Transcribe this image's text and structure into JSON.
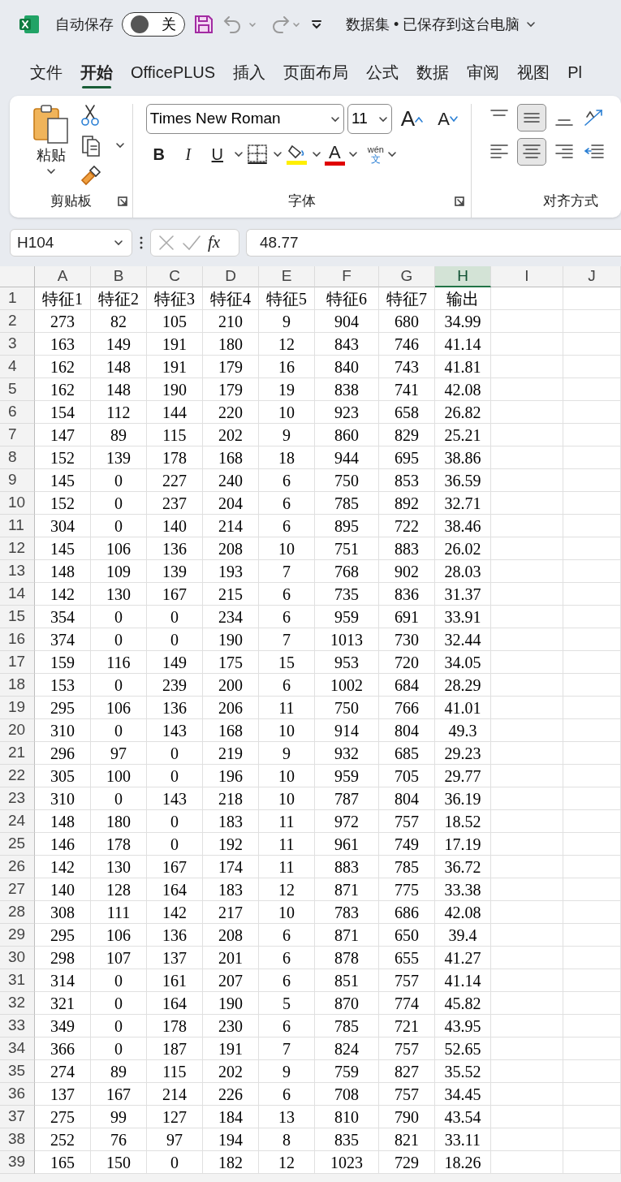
{
  "title_bar": {
    "autosave_label": "自动保存",
    "autosave": {
      "on": false,
      "state_label": "关"
    },
    "title": "数据集 • 已保存到这台电脑"
  },
  "tabs": [
    {
      "label": "文件",
      "selected": false
    },
    {
      "label": "开始",
      "selected": true
    },
    {
      "label": "OfficePLUS",
      "selected": false
    },
    {
      "label": "插入",
      "selected": false
    },
    {
      "label": "页面布局",
      "selected": false
    },
    {
      "label": "公式",
      "selected": false
    },
    {
      "label": "数据",
      "selected": false
    },
    {
      "label": "审阅",
      "selected": false
    },
    {
      "label": "视图",
      "selected": false
    },
    {
      "label": "Pl",
      "selected": false
    }
  ],
  "ribbon": {
    "clipboard": {
      "paste_label": "粘贴",
      "group_label": "剪贴板"
    },
    "font": {
      "font_name": "Times New Roman",
      "font_size": "11",
      "grow_label": "A",
      "shrink_label": "A",
      "bold_label": "B",
      "italic_label": "I",
      "underline_label": "U",
      "font_color_label": "A",
      "phonetic_top": "wén",
      "phonetic_bottom": "文",
      "group_label": "字体"
    },
    "alignment": {
      "group_label": "对齐方式",
      "top_row": [
        {
          "selected": false
        },
        {
          "selected": true
        },
        {
          "selected": false
        }
      ],
      "bottom_row": [
        {
          "selected": false
        },
        {
          "selected": true
        },
        {
          "selected": false
        }
      ]
    }
  },
  "formula_bar": {
    "name_box": "H104",
    "fx_label": "fx",
    "value": "48.77"
  },
  "sheet": {
    "columns": [
      {
        "label": "A",
        "selected": false
      },
      {
        "label": "B",
        "selected": false
      },
      {
        "label": "C",
        "selected": false
      },
      {
        "label": "D",
        "selected": false
      },
      {
        "label": "E",
        "selected": false
      },
      {
        "label": "F",
        "selected": false
      },
      {
        "label": "G",
        "selected": false
      },
      {
        "label": "H",
        "selected": true
      },
      {
        "label": "I",
        "selected": false
      },
      {
        "label": "J",
        "selected": false
      }
    ],
    "rows": [
      {
        "number": "1",
        "cells": [
          "特征1",
          "特征2",
          "特征3",
          "特征4",
          "特征5",
          "特征6",
          "特征7",
          "输出"
        ]
      },
      {
        "number": "2",
        "cells": [
          "273",
          "82",
          "105",
          "210",
          "9",
          "904",
          "680",
          "34.99"
        ]
      },
      {
        "number": "3",
        "cells": [
          "163",
          "149",
          "191",
          "180",
          "12",
          "843",
          "746",
          "41.14"
        ]
      },
      {
        "number": "4",
        "cells": [
          "162",
          "148",
          "191",
          "179",
          "16",
          "840",
          "743",
          "41.81"
        ]
      },
      {
        "number": "5",
        "cells": [
          "162",
          "148",
          "190",
          "179",
          "19",
          "838",
          "741",
          "42.08"
        ]
      },
      {
        "number": "6",
        "cells": [
          "154",
          "112",
          "144",
          "220",
          "10",
          "923",
          "658",
          "26.82"
        ]
      },
      {
        "number": "7",
        "cells": [
          "147",
          "89",
          "115",
          "202",
          "9",
          "860",
          "829",
          "25.21"
        ]
      },
      {
        "number": "8",
        "cells": [
          "152",
          "139",
          "178",
          "168",
          "18",
          "944",
          "695",
          "38.86"
        ]
      },
      {
        "number": "9",
        "cells": [
          "145",
          "0",
          "227",
          "240",
          "6",
          "750",
          "853",
          "36.59"
        ]
      },
      {
        "number": "10",
        "cells": [
          "152",
          "0",
          "237",
          "204",
          "6",
          "785",
          "892",
          "32.71"
        ]
      },
      {
        "number": "11",
        "cells": [
          "304",
          "0",
          "140",
          "214",
          "6",
          "895",
          "722",
          "38.46"
        ]
      },
      {
        "number": "12",
        "cells": [
          "145",
          "106",
          "136",
          "208",
          "10",
          "751",
          "883",
          "26.02"
        ]
      },
      {
        "number": "13",
        "cells": [
          "148",
          "109",
          "139",
          "193",
          "7",
          "768",
          "902",
          "28.03"
        ]
      },
      {
        "number": "14",
        "cells": [
          "142",
          "130",
          "167",
          "215",
          "6",
          "735",
          "836",
          "31.37"
        ]
      },
      {
        "number": "15",
        "cells": [
          "354",
          "0",
          "0",
          "234",
          "6",
          "959",
          "691",
          "33.91"
        ]
      },
      {
        "number": "16",
        "cells": [
          "374",
          "0",
          "0",
          "190",
          "7",
          "1013",
          "730",
          "32.44"
        ]
      },
      {
        "number": "17",
        "cells": [
          "159",
          "116",
          "149",
          "175",
          "15",
          "953",
          "720",
          "34.05"
        ]
      },
      {
        "number": "18",
        "cells": [
          "153",
          "0",
          "239",
          "200",
          "6",
          "1002",
          "684",
          "28.29"
        ]
      },
      {
        "number": "19",
        "cells": [
          "295",
          "106",
          "136",
          "206",
          "11",
          "750",
          "766",
          "41.01"
        ]
      },
      {
        "number": "20",
        "cells": [
          "310",
          "0",
          "143",
          "168",
          "10",
          "914",
          "804",
          "49.3"
        ]
      },
      {
        "number": "21",
        "cells": [
          "296",
          "97",
          "0",
          "219",
          "9",
          "932",
          "685",
          "29.23"
        ]
      },
      {
        "number": "22",
        "cells": [
          "305",
          "100",
          "0",
          "196",
          "10",
          "959",
          "705",
          "29.77"
        ]
      },
      {
        "number": "23",
        "cells": [
          "310",
          "0",
          "143",
          "218",
          "10",
          "787",
          "804",
          "36.19"
        ]
      },
      {
        "number": "24",
        "cells": [
          "148",
          "180",
          "0",
          "183",
          "11",
          "972",
          "757",
          "18.52"
        ]
      },
      {
        "number": "25",
        "cells": [
          "146",
          "178",
          "0",
          "192",
          "11",
          "961",
          "749",
          "17.19"
        ]
      },
      {
        "number": "26",
        "cells": [
          "142",
          "130",
          "167",
          "174",
          "11",
          "883",
          "785",
          "36.72"
        ]
      },
      {
        "number": "27",
        "cells": [
          "140",
          "128",
          "164",
          "183",
          "12",
          "871",
          "775",
          "33.38"
        ]
      },
      {
        "number": "28",
        "cells": [
          "308",
          "111",
          "142",
          "217",
          "10",
          "783",
          "686",
          "42.08"
        ]
      },
      {
        "number": "29",
        "cells": [
          "295",
          "106",
          "136",
          "208",
          "6",
          "871",
          "650",
          "39.4"
        ]
      },
      {
        "number": "30",
        "cells": [
          "298",
          "107",
          "137",
          "201",
          "6",
          "878",
          "655",
          "41.27"
        ]
      },
      {
        "number": "31",
        "cells": [
          "314",
          "0",
          "161",
          "207",
          "6",
          "851",
          "757",
          "41.14"
        ]
      },
      {
        "number": "32",
        "cells": [
          "321",
          "0",
          "164",
          "190",
          "5",
          "870",
          "774",
          "45.82"
        ]
      },
      {
        "number": "33",
        "cells": [
          "349",
          "0",
          "178",
          "230",
          "6",
          "785",
          "721",
          "43.95"
        ]
      },
      {
        "number": "34",
        "cells": [
          "366",
          "0",
          "187",
          "191",
          "7",
          "824",
          "757",
          "52.65"
        ]
      },
      {
        "number": "35",
        "cells": [
          "274",
          "89",
          "115",
          "202",
          "9",
          "759",
          "827",
          "35.52"
        ]
      },
      {
        "number": "36",
        "cells": [
          "137",
          "167",
          "214",
          "226",
          "6",
          "708",
          "757",
          "34.45"
        ]
      },
      {
        "number": "37",
        "cells": [
          "275",
          "99",
          "127",
          "184",
          "13",
          "810",
          "790",
          "43.54"
        ]
      },
      {
        "number": "38",
        "cells": [
          "252",
          "76",
          "97",
          "194",
          "8",
          "835",
          "821",
          "33.11"
        ]
      },
      {
        "number": "39",
        "cells": [
          "165",
          "150",
          "0",
          "182",
          "12",
          "1023",
          "729",
          "18.26"
        ]
      }
    ]
  }
}
